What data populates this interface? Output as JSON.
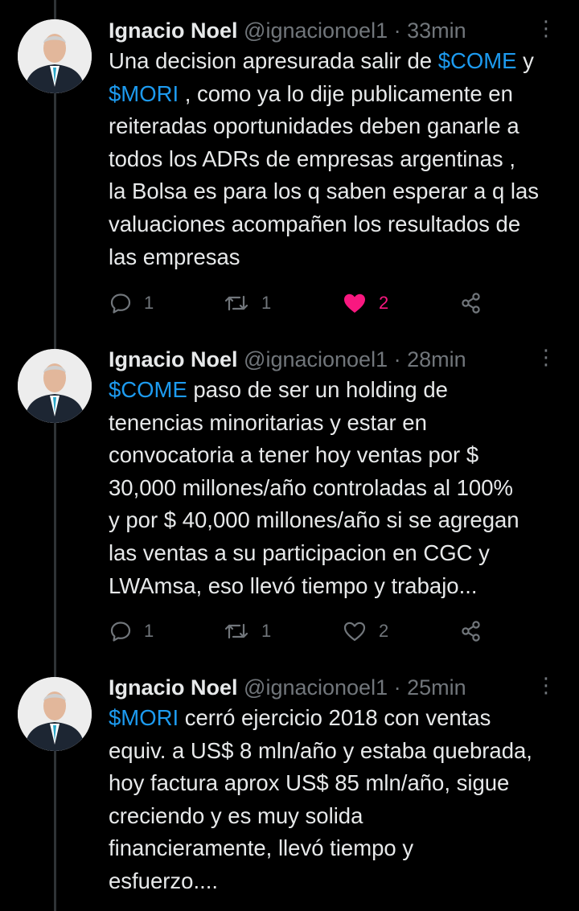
{
  "tweets": [
    {
      "name": "Ignacio Noel",
      "handle": "@ignacionoel1",
      "separator": "·",
      "time": "33min",
      "more_glyph": "⋮",
      "segments": [
        {
          "t": "Una decision apresurada salir de "
        },
        {
          "t": "$COME",
          "tag": true
        },
        {
          "t": " y\n"
        },
        {
          "t": "$MORI",
          "tag": true
        },
        {
          "t": " , como ya lo dije publicamente en\nreiteradas oportunidades deben ganarle a\ntodos los ADRs de empresas argentinas ,\nla Bolsa es para los q saben esperar a q las\nvaluaciones acompañen los resultados de\nlas empresas"
        }
      ],
      "replies": "1",
      "retweets": "1",
      "likes": "2",
      "liked": true
    },
    {
      "name": "Ignacio Noel",
      "handle": "@ignacionoel1",
      "separator": "·",
      "time": "28min",
      "more_glyph": "⋮",
      "segments": [
        {
          "t": "$COME",
          "tag": true
        },
        {
          "t": " paso de ser un holding de\ntenencias minoritarias y estar en\nconvocatoria a tener hoy ventas por $\n30,000 millones/año controladas al 100%\ny por $ 40,000 millones/año si se agregan\nlas ventas a su participacion en CGC y\nLWAmsa, eso llevó tiempo y trabajo..."
        }
      ],
      "replies": "1",
      "retweets": "1",
      "likes": "2",
      "liked": false
    },
    {
      "name": "Ignacio Noel",
      "handle": "@ignacionoel1",
      "separator": "·",
      "time": "25min",
      "more_glyph": "⋮",
      "segments": [
        {
          "t": "$MORI",
          "tag": true
        },
        {
          "t": " cerró ejercicio 2018 con ventas\nequiv. a US$ 8 mln/año y estaba quebrada,\nhoy factura aprox US$ 85 mln/año, sigue\ncreciendo y es muy solida\nfinancieramente, llevó tiempo y\nesfuerzo...."
        }
      ]
    }
  ],
  "colors": {
    "background": "#000000",
    "text": "#e7e9ea",
    "secondary": "#71767b",
    "cashtag": "#1d9bf0",
    "like": "#f91880",
    "thread_line": "#2f3336"
  },
  "icons": {
    "reply": "reply-icon",
    "retweet": "retweet-icon",
    "like": "heart-icon",
    "share": "share-icon",
    "more": "more-vertical-icon"
  }
}
